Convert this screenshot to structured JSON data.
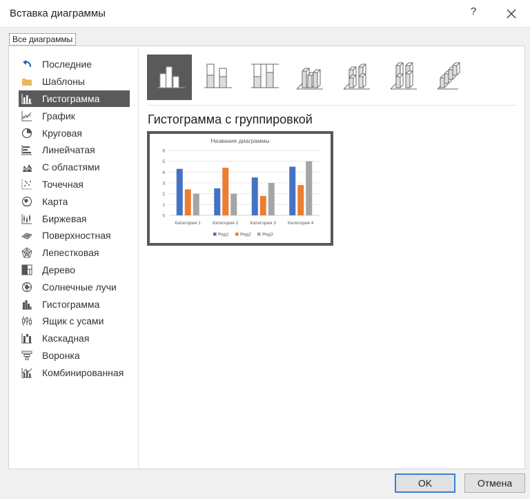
{
  "window": {
    "title": "Вставка диаграммы",
    "help_label": "?"
  },
  "tab": {
    "label": "Все диаграммы"
  },
  "sidebar": {
    "items": [
      {
        "label": "Последние",
        "icon": "recent-arrow-icon"
      },
      {
        "label": "Шаблоны",
        "icon": "folder-icon"
      },
      {
        "label": "Гистограмма",
        "icon": "column-chart-icon",
        "selected": true
      },
      {
        "label": "График",
        "icon": "line-chart-icon"
      },
      {
        "label": "Круговая",
        "icon": "pie-chart-icon"
      },
      {
        "label": "Линейчатая",
        "icon": "bar-chart-icon"
      },
      {
        "label": "С областями",
        "icon": "area-chart-icon"
      },
      {
        "label": "Точечная",
        "icon": "scatter-chart-icon"
      },
      {
        "label": "Карта",
        "icon": "map-chart-icon"
      },
      {
        "label": "Биржевая",
        "icon": "stock-chart-icon"
      },
      {
        "label": "Поверхностная",
        "icon": "surface-chart-icon"
      },
      {
        "label": "Лепестковая",
        "icon": "radar-chart-icon"
      },
      {
        "label": "Дерево",
        "icon": "treemap-chart-icon"
      },
      {
        "label": "Солнечные лучи",
        "icon": "sunburst-chart-icon"
      },
      {
        "label": "Гистограмма",
        "icon": "histogram-chart-icon"
      },
      {
        "label": "Ящик с усами",
        "icon": "box-whisker-chart-icon"
      },
      {
        "label": "Каскадная",
        "icon": "waterfall-chart-icon"
      },
      {
        "label": "Воронка",
        "icon": "funnel-chart-icon"
      },
      {
        "label": "Комбинированная",
        "icon": "combo-chart-icon"
      }
    ]
  },
  "subtypes": {
    "selected_title": "Гистограмма с группировкой",
    "icons": [
      "clustered-column-icon",
      "stacked-column-icon",
      "100-stacked-column-icon",
      "3d-clustered-column-icon",
      "3d-stacked-column-icon",
      "3d-100-stacked-column-icon",
      "3d-column-icon"
    ]
  },
  "chart_data": {
    "type": "bar",
    "title": "Название диаграммы",
    "categories": [
      "Категория 1",
      "Категория 2",
      "Категория 3",
      "Категория 4"
    ],
    "series": [
      {
        "name": "Ряд1",
        "values": [
          4.3,
          2.5,
          3.5,
          4.5
        ],
        "color": "#4472c4"
      },
      {
        "name": "Ряд2",
        "values": [
          2.4,
          4.4,
          1.8,
          2.8
        ],
        "color": "#ed7d31"
      },
      {
        "name": "Ряд3",
        "values": [
          2.0,
          2.0,
          3.0,
          5.0
        ],
        "color": "#a5a5a5"
      }
    ],
    "ylim": [
      0,
      6
    ],
    "yticks": [
      0,
      1,
      2,
      3,
      4,
      5,
      6
    ],
    "grid": true,
    "legend": "bottom"
  },
  "footer": {
    "ok_label": "OK",
    "cancel_label": "Отмена"
  },
  "colors": {
    "selection": "#5a5a5a",
    "accent_border": "#3c7fd5"
  }
}
